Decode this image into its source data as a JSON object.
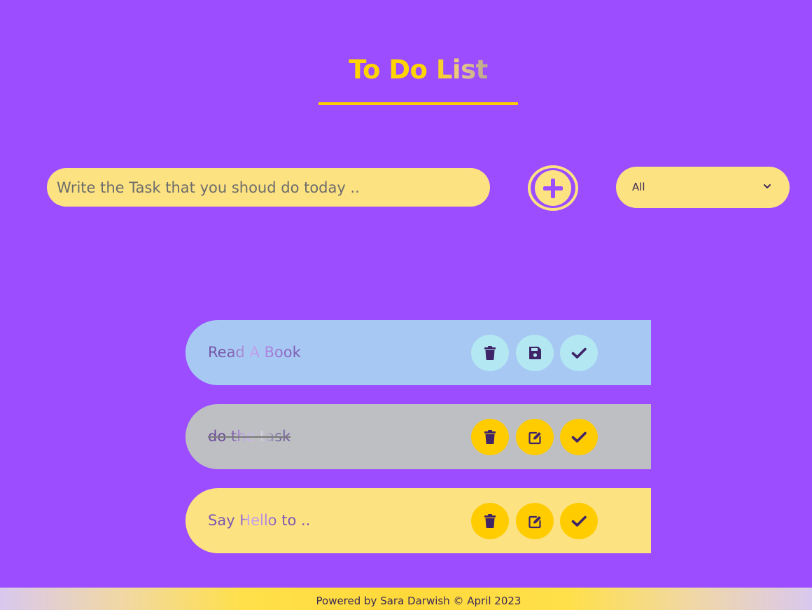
{
  "header": {
    "title": "To Do List"
  },
  "input": {
    "placeholder": "Write the Task that you shoud do today .."
  },
  "filter": {
    "selected": "All"
  },
  "todos": [
    {
      "text": "Read A Book",
      "state": "editing"
    },
    {
      "text": "do the task",
      "state": "completed"
    },
    {
      "text": "Say Hello to ..",
      "state": "normal"
    }
  ],
  "icons": {
    "add": "plus-circle-icon",
    "delete": "trash-icon",
    "edit": "pen-square-icon",
    "save": "floppy-disk-icon",
    "check": "check-icon",
    "dropdown": "chevron-down-icon"
  },
  "colors": {
    "background": "#9b4dff",
    "accent": "#ffcc00",
    "pale_yellow": "#fde282",
    "icon_dark": "#3f2468"
  },
  "footer": {
    "text": "Powered by Sara Darwish © April 2023"
  }
}
